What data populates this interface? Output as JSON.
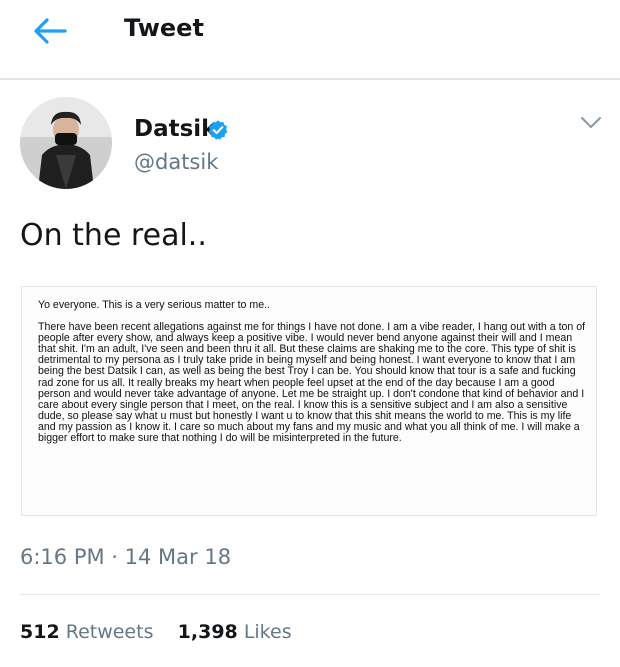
{
  "header": {
    "title": "Tweet",
    "back_icon": "arrow-left-icon"
  },
  "colors": {
    "accent": "#1da1f2",
    "text": "#14171a",
    "secondary_text": "#657786",
    "divider": "#e1e8ed"
  },
  "author": {
    "display_name": "Datsik",
    "handle": "@datsik",
    "verified": true,
    "verified_icon": "verified-badge-icon",
    "menu_icon": "chevron-down-icon"
  },
  "tweet": {
    "text": "On the real..",
    "timestamp": "6:16 PM · 14 Mar 18",
    "retweets": "512",
    "retweets_label": "Retweets",
    "likes": "1,398",
    "likes_label": "Likes"
  },
  "media": {
    "paragraphs": [
      "Yo everyone. This is a very serious matter to me..",
      "There have been recent allegations against me for things I have not done. I am a vibe reader, I hang out with a ton of people after every show, and always keep a positive vibe. I would never bend anyone against their will and I mean that shit. I'm an adult, I've seen and been thru it all. But these claims are shaking me to the core.  This type of shit is detrimental to my persona as I truly take pride in being myself and being honest. I want everyone to know that I am being the best Datsik I can, as well as being the best Troy I can be.  You should know that tour is a safe and fucking rad zone for us all. It really breaks my heart when people feel upset at the end of the day because I am a good person and would never take advantage of anyone. Let me be straight up. I don't condone that kind of behavior and I care about every single person that I meet, on the real. I know this is a sensitive subject and I am also a sensitive dude, so please say what u must but honestly I want u to know that this shit means the world to me. This is my life and my passion as I know it. I care so much about my fans and my music and what you all think of me.  I will make a bigger effort to make sure that nothing I do will be misinterpreted in the future."
    ]
  }
}
